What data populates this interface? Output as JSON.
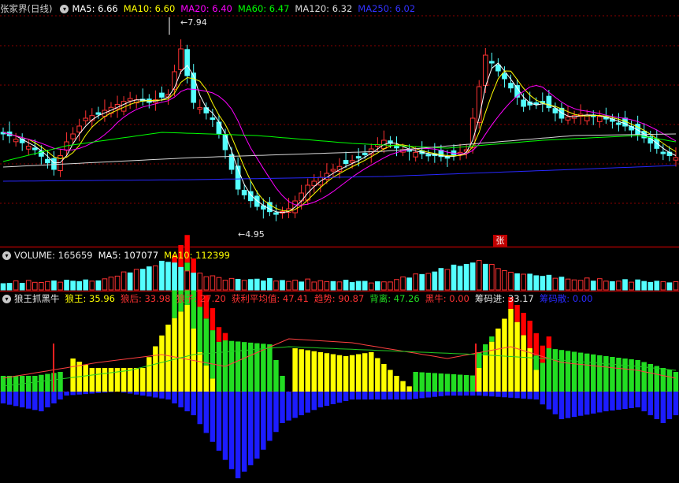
{
  "colors": {
    "up": "#ff3232",
    "down": "#54ffff",
    "ma5": "#ffffff",
    "ma10": "#ffff00",
    "ma20": "#ff00ff",
    "ma60": "#00ff00",
    "ma120": "#d8d8d8",
    "ma250": "#2828ff",
    "grid": "#8b0000",
    "wang": "#ffff00",
    "hou": "#ff0000",
    "zi": "#22dd22",
    "blue": "#1c1cff"
  },
  "main": {
    "icon": "chevron-down-icon",
    "title": "张家界(日线)",
    "ma5": "MA5: 6.66",
    "ma10": "MA10: 6.60",
    "ma20": "MA20: 6.40",
    "ma60": "MA60: 6.47",
    "ma120": "MA120: 6.32",
    "ma250": "MA250: 6.02",
    "high_label": "7.94",
    "low_label": "4.95",
    "limit_tag": "张"
  },
  "volume": {
    "icon": "chevron-down-icon",
    "label": "VOLUME: 165659",
    "ma5": "MA5: 107077",
    "ma10": "MA10: 112399"
  },
  "indicator": {
    "icon": "chevron-down-icon",
    "title": "狼王抓黑牛",
    "wang": "狼王: 35.96",
    "hou": "狼后: 33.98",
    "zi": "狼子: 27.20",
    "profit": "获利平均值: 47.41",
    "trend": "趋势: 90.87",
    "diverge": "背离: 47.26",
    "bull": "黑牛: 0.00",
    "chip_in": "筹码进: 33.17",
    "chip_out": "筹码散: 0.00"
  }
}
